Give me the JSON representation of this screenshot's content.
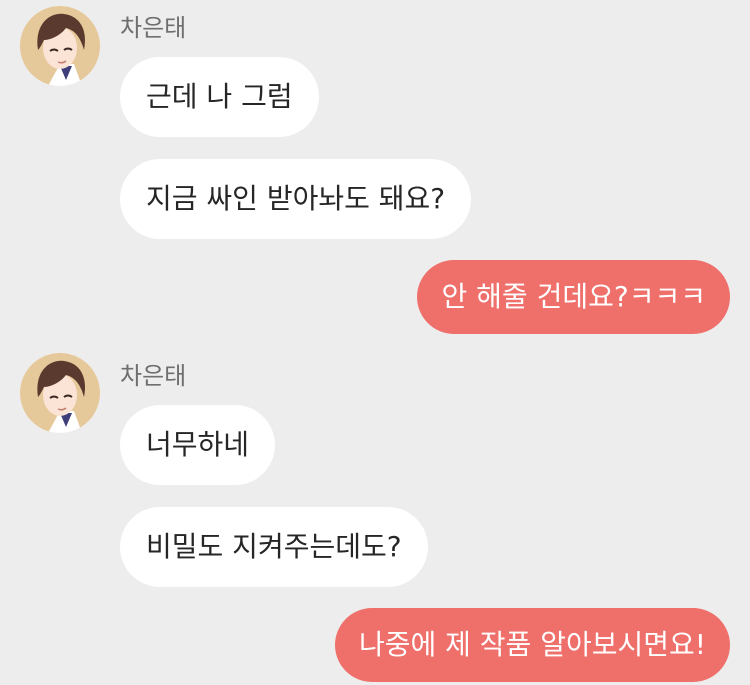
{
  "colors": {
    "background": "#ededed",
    "incoming_bubble": "#ffffff",
    "outgoing_bubble": "#ef6f6b",
    "sender_name": "#6f6f6f"
  },
  "conversation": {
    "groups": [
      {
        "sender": "차은태",
        "avatar_icon": "anime-boy-avatar-icon",
        "messages": [
          "근데 나 그럼",
          "지금 싸인 받아놔도 돼요?"
        ]
      },
      {
        "sender": "me",
        "messages": [
          "안 해줄 건데요?ㅋㅋㅋ"
        ]
      },
      {
        "sender": "차은태",
        "avatar_icon": "anime-boy-avatar-icon",
        "messages": [
          "너무하네",
          "비밀도 지켜주는데도?"
        ]
      },
      {
        "sender": "me",
        "messages": [
          "나중에 제 작품 알아보시면요!"
        ]
      }
    ]
  }
}
